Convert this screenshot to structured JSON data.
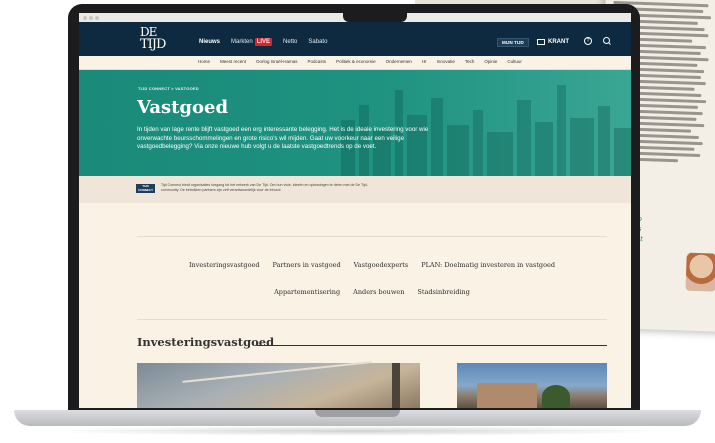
{
  "nav": {
    "logo_line1": "DE",
    "logo_line2": "TIJD",
    "items": [
      "Nieuws",
      "Markten",
      "Netto",
      "Sabato"
    ],
    "live_badge": "LIVE",
    "mijn_tijd": "MIJN TIJD",
    "krant": "KRANT",
    "help_symbol": "?"
  },
  "subnav": {
    "items": [
      "Home",
      "Meest recent",
      "Oorlog Israël-Hamas",
      "Podcasts",
      "Politiek & economie",
      "Ondernemen",
      "Hr",
      "Innovatie",
      "Tech",
      "Opinie",
      "Cultuur"
    ]
  },
  "hero": {
    "breadcrumb": "TIJD CONNECT  >  VASTGOED",
    "title": "Vastgoed",
    "intro": "In tijden van lage rente blijft vastgoed een erg interessante belegging. Het is de ideale investering voor wie onverwachte beursschommelingen en grote risico's wil mijden. Gaat uw voorkeur naar een veilige vastgoedbelegging? Via onze nieuwe hub volgt u de laatste vastgoedtrends op de voet."
  },
  "info": {
    "badge": "TIJD CONNECT",
    "text": "Tijd Connect biedt organisaties toegang tot het netwerk van De Tijd. Om hun visie, ideeën en oplossingen te delen met de De Tijd-community. De betrokken partners zijn zelf verantwoordelijk voor de inhoud."
  },
  "tags": {
    "row1": [
      "Investeringsvastgoed",
      "Partners in vastgoed",
      "Vastgoedexperts",
      "PLAN: Doelmatig investeren in vastgoed"
    ],
    "row2": [
      "Appartementisering",
      "Anders bouwen",
      "Stadsinbreiding"
    ]
  },
  "section": {
    "title": "Investeringsvastgoed"
  },
  "background_magazine": {
    "green_text": "aan oplos\nk zorgverb\nziekenhuis\nonzorgcent\n\nctor\n\niste"
  },
  "colors": {
    "navy": "#0d2a40",
    "teal": "#1f9280",
    "cream": "#fbf2e6",
    "live_red": "#d6262e"
  },
  "icons": [
    "help-icon",
    "search-icon",
    "newspaper-icon"
  ]
}
